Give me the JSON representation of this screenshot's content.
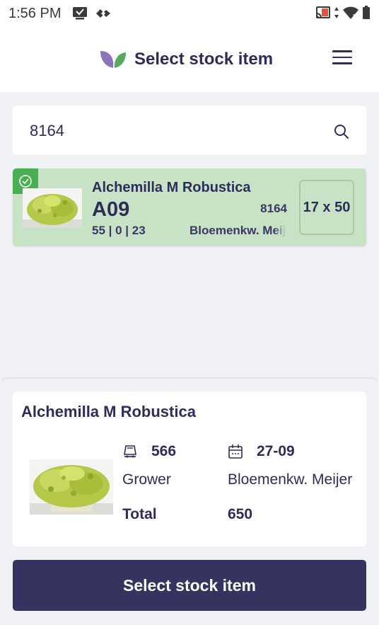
{
  "status_bar": {
    "time": "1:56 PM",
    "icons": [
      "message-icon",
      "data-saver-icon",
      "cast-icon",
      "data-arrows-icon",
      "wifi-icon",
      "battery-icon"
    ]
  },
  "header": {
    "title": "Select stock item",
    "icons": [
      "leaf-logo-icon",
      "hamburger-menu-icon"
    ]
  },
  "search": {
    "value": "8164",
    "placeholder": ""
  },
  "results": [
    {
      "name": "Alchemilla M Robustica",
      "location": "A09",
      "code": "8164",
      "counts": "55 | 0 | 23",
      "grower": "Bloemenkw. Meijer",
      "size": "17 x 50",
      "selected": true
    }
  ],
  "detail": {
    "title": "Alchemilla M Robustica",
    "quantity": "566",
    "date": "27-09",
    "grower_label": "Grower",
    "grower_value": "Bloemenkw. Meijer",
    "total_label": "Total",
    "total_value": "650"
  },
  "actions": {
    "select_label": "Select stock item"
  },
  "colors": {
    "primary": "#35335f",
    "text": "#2e2c5a",
    "selected_card": "#c8e2c6",
    "check_badge": "#4aae53",
    "logo_purple": "#8b73bd",
    "logo_green": "#56a85a",
    "background": "#f1f2f6"
  }
}
